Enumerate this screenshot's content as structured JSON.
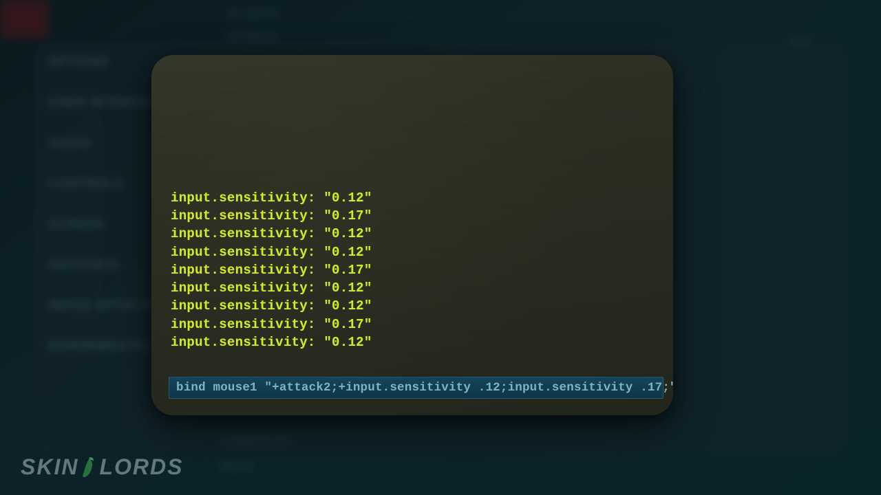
{
  "background": {
    "sidebar": [
      "OPTIONS",
      "USER INTERFACE",
      "AUDIO",
      "CONTROLS",
      "SCREEN",
      "GRAPHICS",
      "IMAGE EFFECTS",
      "EXPERIMENTAL"
    ],
    "headerItems": [
      "UI SETS",
      "UI SETS"
    ],
    "footerItems": [
      "CONSOLES",
      "PETS"
    ],
    "rightBadge": "SAVE"
  },
  "console": {
    "output": [
      "input.sensitivity: \"0.12\"",
      "input.sensitivity: \"0.17\"",
      "input.sensitivity: \"0.12\"",
      "input.sensitivity: \"0.12\"",
      "input.sensitivity: \"0.17\"",
      "input.sensitivity: \"0.12\"",
      "input.sensitivity: \"0.12\"",
      "input.sensitivity: \"0.17\"",
      "input.sensitivity: \"0.12\""
    ],
    "input": "bind mouse1 \"+attack2;+input.sensitivity .12;input.sensitivity .17;\""
  },
  "watermark": {
    "left": "SKIN",
    "right": "LORDS"
  }
}
